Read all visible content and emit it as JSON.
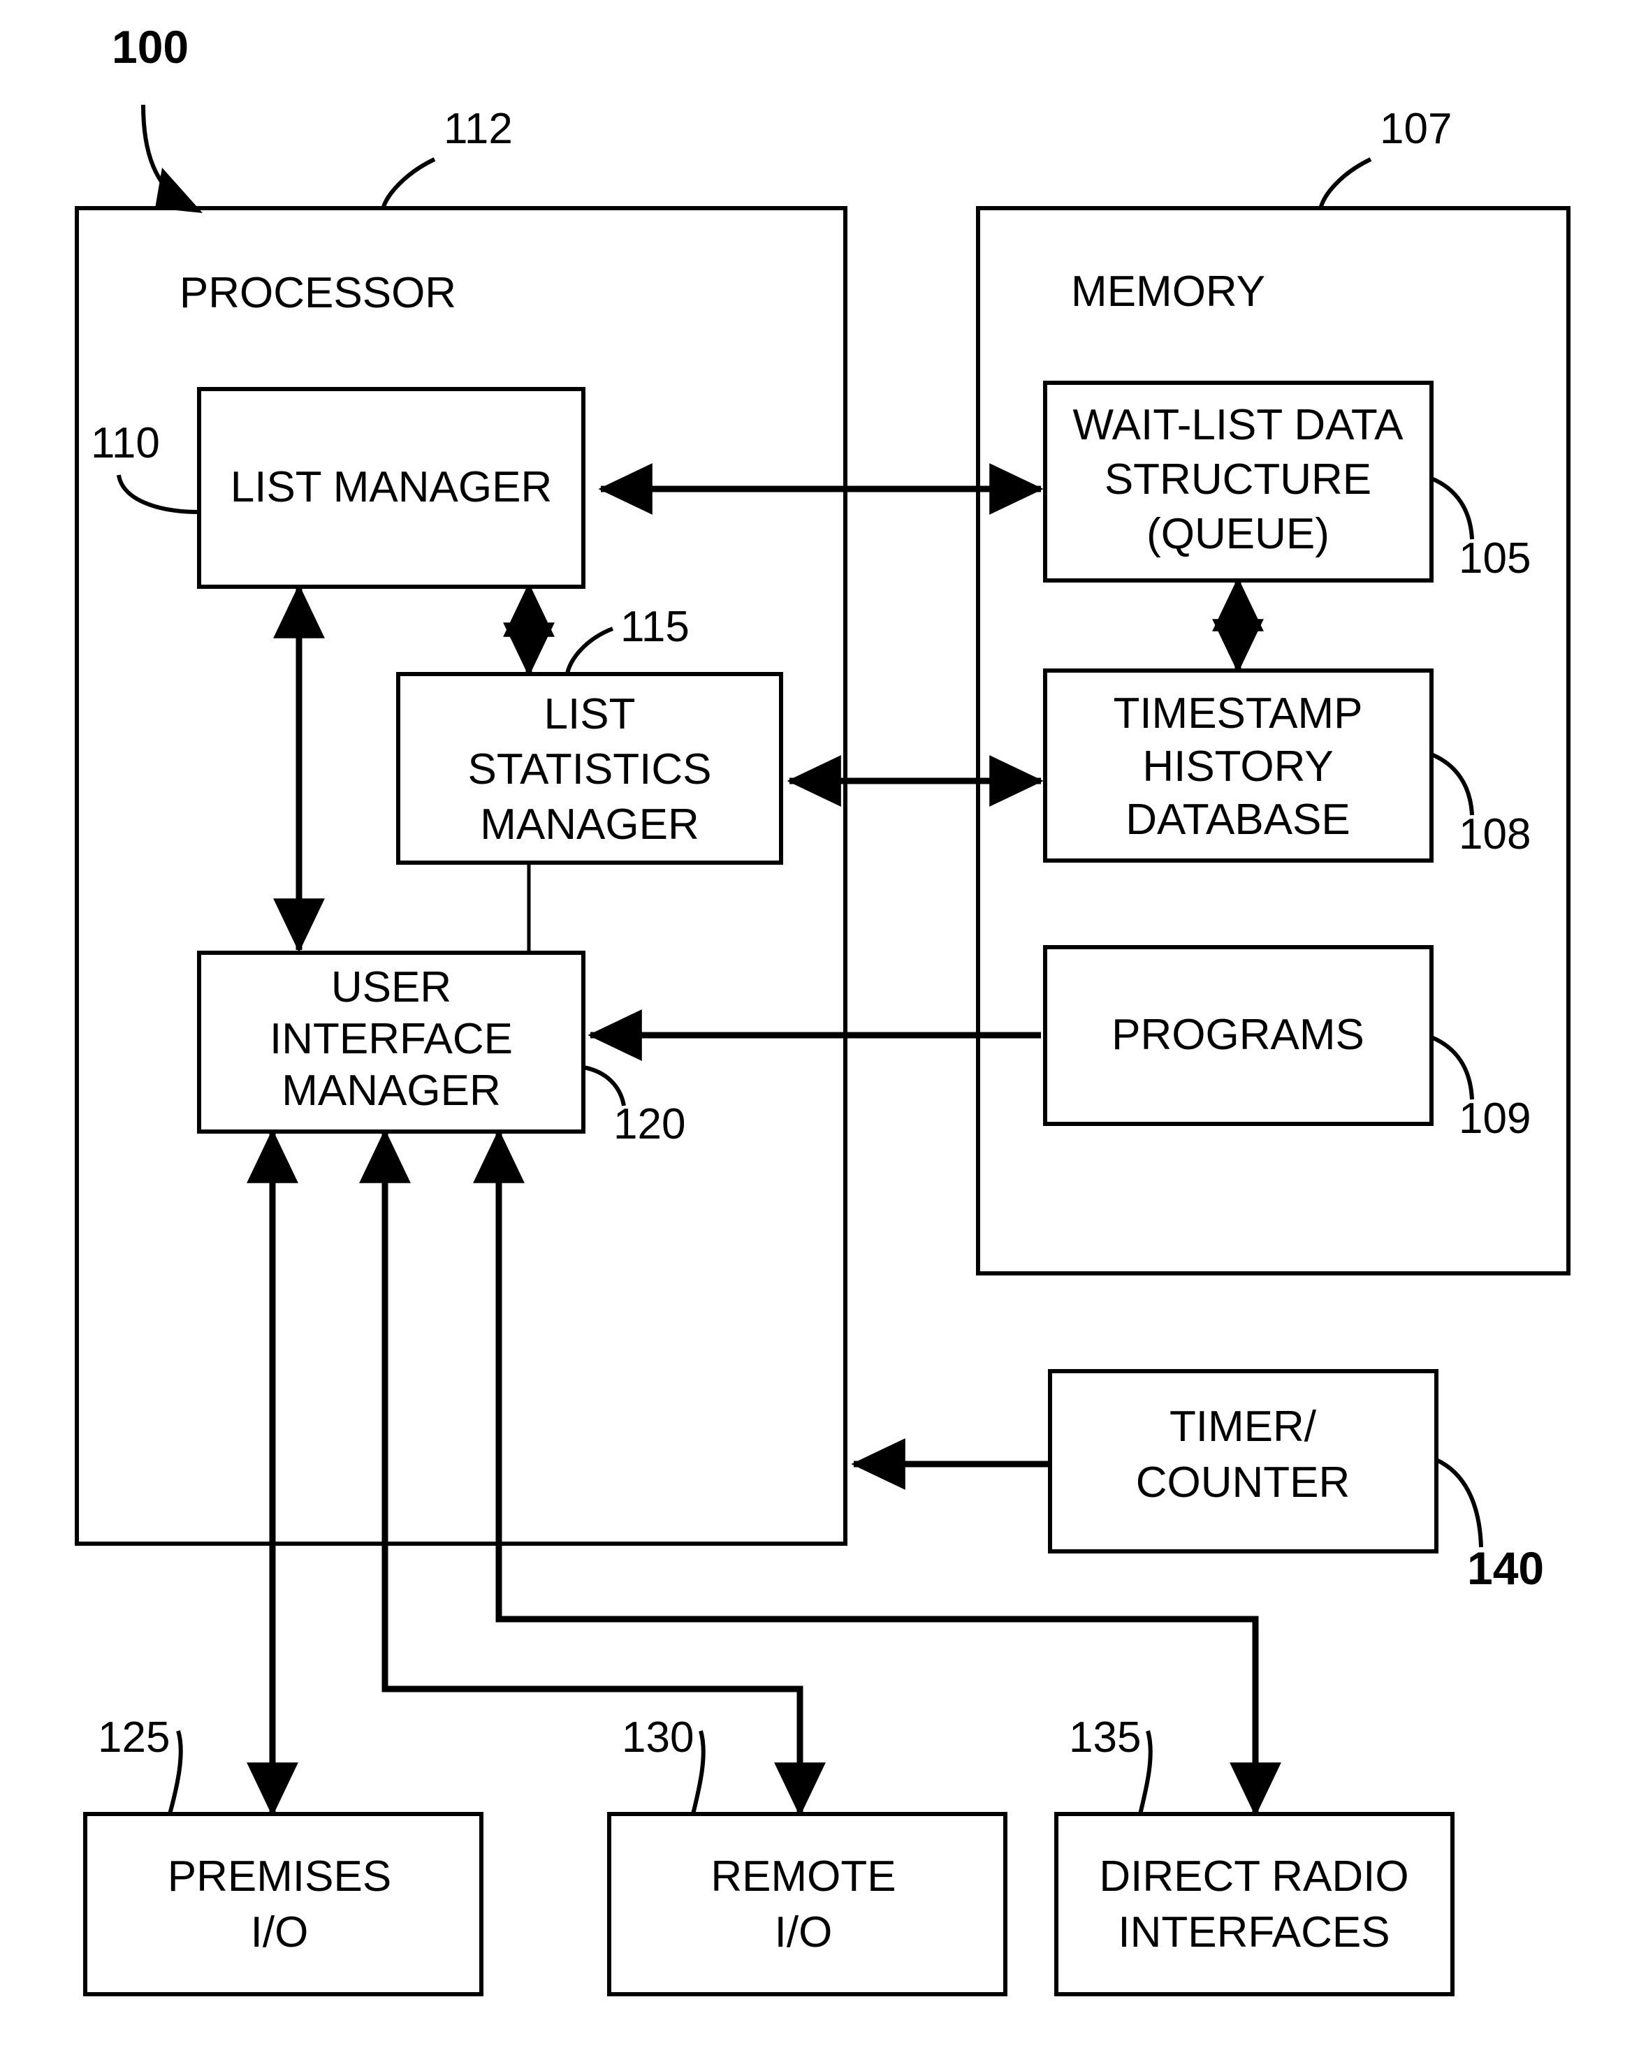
{
  "figure": {
    "root_reference": "100"
  },
  "containers": [
    {
      "id": "processor",
      "label": "PROCESSOR",
      "reference": "112"
    },
    {
      "id": "memory",
      "label": "MEMORY",
      "reference": "107"
    }
  ],
  "blocks": [
    {
      "id": "list-manager",
      "reference": "110",
      "lines": [
        "LIST MANAGER"
      ]
    },
    {
      "id": "list-statistics-manager",
      "reference": "115",
      "lines": [
        "LIST",
        "STATISTICS",
        "MANAGER"
      ]
    },
    {
      "id": "user-interface-manager",
      "reference": "120",
      "lines": [
        "USER",
        "INTERFACE",
        "MANAGER"
      ]
    },
    {
      "id": "wait-list-data-structure",
      "reference": "105",
      "lines": [
        "WAIT-LIST DATA",
        "STRUCTURE",
        "(QUEUE)"
      ]
    },
    {
      "id": "timestamp-history-database",
      "reference": "108",
      "lines": [
        "TIMESTAMP",
        "HISTORY",
        "DATABASE"
      ]
    },
    {
      "id": "programs",
      "reference": "109",
      "lines": [
        "PROGRAMS"
      ]
    },
    {
      "id": "timer-counter",
      "reference": "140",
      "lines": [
        "TIMER/",
        "COUNTER"
      ]
    },
    {
      "id": "premises-io",
      "reference": "125",
      "lines": [
        "PREMISES",
        "I/O"
      ]
    },
    {
      "id": "remote-io",
      "reference": "130",
      "lines": [
        "REMOTE",
        "I/O"
      ]
    },
    {
      "id": "direct-radio-interfaces",
      "reference": "135",
      "lines": [
        "DIRECT RADIO",
        "INTERFACES"
      ]
    }
  ],
  "connections": [
    {
      "id": "list-manager-to-wait-list",
      "from": "list-manager",
      "to": "wait-list-data-structure",
      "arrows": "both"
    },
    {
      "id": "list-manager-to-list-statistics-manager",
      "from": "list-manager",
      "to": "list-statistics-manager",
      "arrows": "both"
    },
    {
      "id": "list-manager-to-user-interface-manager",
      "from": "list-manager",
      "to": "user-interface-manager",
      "arrows": "both"
    },
    {
      "id": "list-statistics-manager-to-timestamp-history-database",
      "from": "list-statistics-manager",
      "to": "timestamp-history-database",
      "arrows": "both"
    },
    {
      "id": "list-statistics-manager-to-user-interface-manager",
      "from": "list-statistics-manager",
      "to": "user-interface-manager",
      "arrows": "none"
    },
    {
      "id": "wait-list-to-timestamp-history-database",
      "from": "wait-list-data-structure",
      "to": "timestamp-history-database",
      "arrows": "both"
    },
    {
      "id": "programs-to-user-interface-manager",
      "from": "programs",
      "to": "user-interface-manager",
      "arrows": "single"
    },
    {
      "id": "timer-counter-to-processor",
      "from": "timer-counter",
      "to": "processor",
      "arrows": "single"
    },
    {
      "id": "user-interface-manager-to-premises-io",
      "from": "user-interface-manager",
      "to": "premises-io",
      "arrows": "both"
    },
    {
      "id": "user-interface-manager-to-remote-io",
      "from": "user-interface-manager",
      "to": "remote-io",
      "arrows": "single"
    },
    {
      "id": "user-interface-manager-to-direct-radio-interfaces",
      "from": "user-interface-manager",
      "to": "direct-radio-interfaces",
      "arrows": "single"
    }
  ]
}
